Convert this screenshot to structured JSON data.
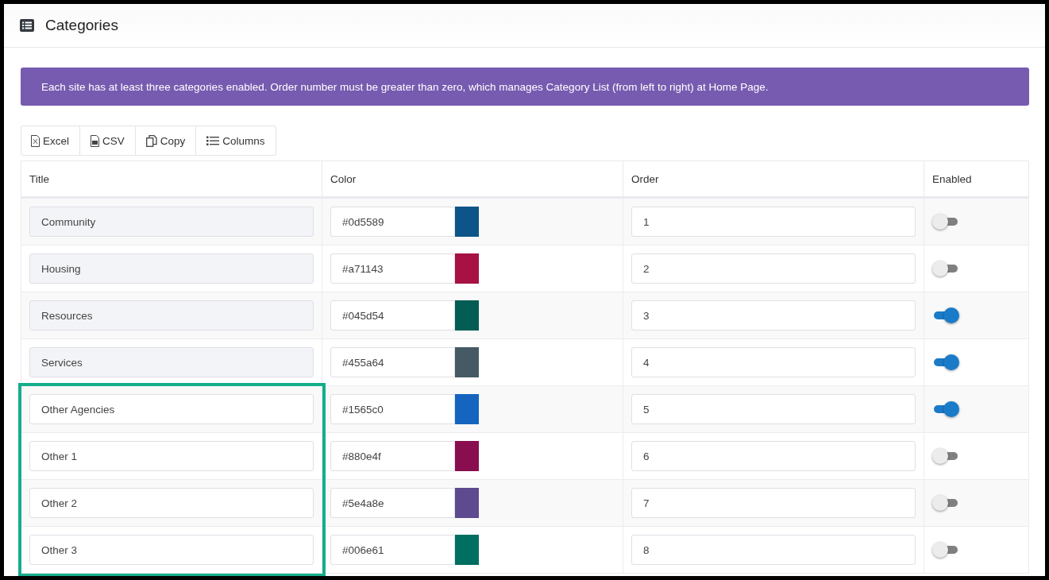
{
  "page": {
    "title": "Categories"
  },
  "notice": "Each site has at least three categories enabled. Order number must be greater than zero, which manages Category List (from left to right) at Home Page.",
  "export_buttons": [
    {
      "kind": "excel",
      "label": "Excel"
    },
    {
      "kind": "csv",
      "label": "CSV"
    },
    {
      "kind": "copy",
      "label": "Copy"
    },
    {
      "kind": "columns",
      "label": "Columns"
    }
  ],
  "table": {
    "columns": [
      "Title",
      "Color",
      "Order",
      "Enabled"
    ],
    "rows": [
      {
        "title": "Community",
        "title_disabled": true,
        "color_value": "#0d5589",
        "color": "#0d5589",
        "order": "1",
        "enabled": false,
        "highlighted": false
      },
      {
        "title": "Housing",
        "title_disabled": true,
        "color_value": "#a71143",
        "color": "#a71143",
        "order": "2",
        "enabled": false,
        "highlighted": false
      },
      {
        "title": "Resources",
        "title_disabled": true,
        "color_value": "#045d54",
        "color": "#045d54",
        "order": "3",
        "enabled": true,
        "highlighted": false
      },
      {
        "title": "Services",
        "title_disabled": true,
        "color_value": "#455a64",
        "color": "#455a64",
        "order": "4",
        "enabled": true,
        "highlighted": false
      },
      {
        "title": "Other Agencies",
        "title_disabled": false,
        "color_value": "#1565c0",
        "color": "#1565c0",
        "order": "5",
        "enabled": true,
        "highlighted": true
      },
      {
        "title": "Other 1",
        "title_disabled": false,
        "color_value": "#880e4f",
        "color": "#880e4f",
        "order": "6",
        "enabled": false,
        "highlighted": true
      },
      {
        "title": "Other 2",
        "title_disabled": false,
        "color_value": "#5e4a8e",
        "color": "#5e4a8e",
        "order": "7",
        "enabled": false,
        "highlighted": true
      },
      {
        "title": "Other 3",
        "title_disabled": false,
        "color_value": "#006e61",
        "color": "#006e61",
        "order": "8",
        "enabled": false,
        "highlighted": true
      }
    ]
  }
}
